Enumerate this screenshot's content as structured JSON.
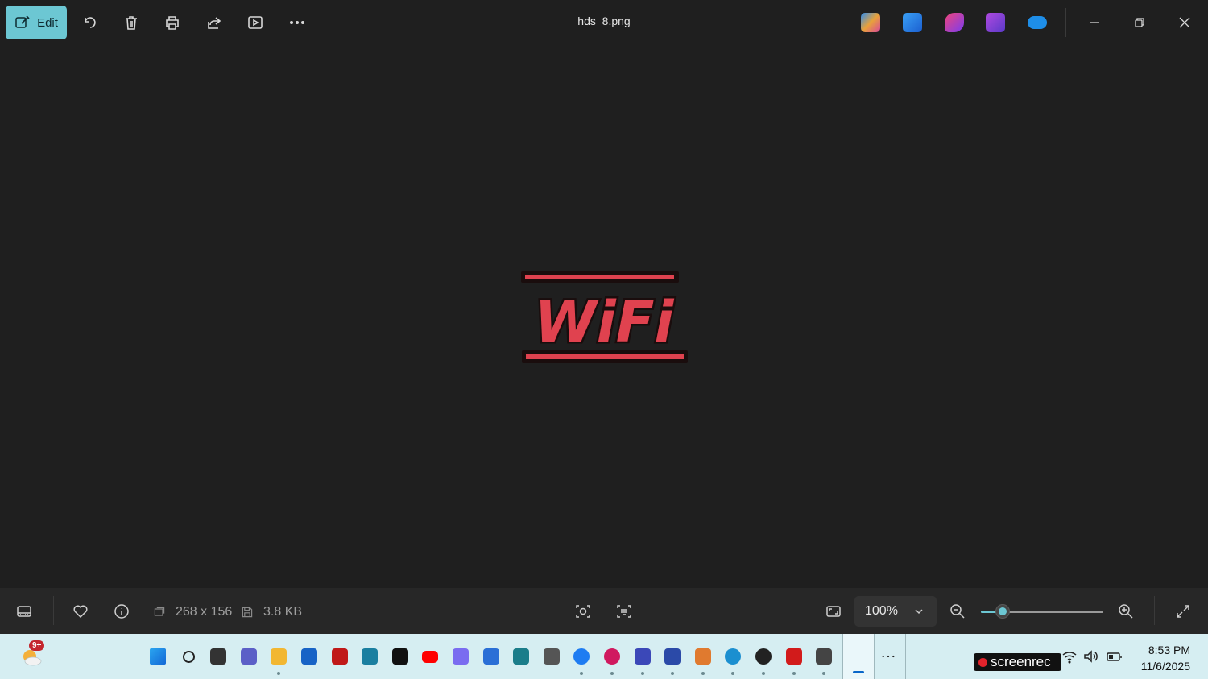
{
  "window": {
    "title": "hds_8.png",
    "edit_label": "Edit"
  },
  "toolbar": {
    "icons": [
      "rotate-icon",
      "delete-icon",
      "print-icon",
      "share-icon",
      "slideshow-icon",
      "more-icon"
    ]
  },
  "header_apps": [
    "copilot-icon",
    "photos-icon",
    "designer-icon",
    "clipchamp-icon",
    "onedrive-icon"
  ],
  "image": {
    "text": "WiFi",
    "text_color": "#e0424f",
    "outline_color": "#1a0d0d"
  },
  "bottombar": {
    "dimensions": "268 x 156",
    "file_size": "3.8 KB",
    "zoom_value": "100%",
    "zoom_slider_level": 0.18
  },
  "taskbar": {
    "weather_badge": "9+",
    "screenrec_label": "screenrec",
    "time": "8:53 PM",
    "date": "11/6/2025",
    "apps": [
      {
        "name": "start-icon",
        "color": "#1a8fe0"
      },
      {
        "name": "search-icon",
        "color": "#222222"
      },
      {
        "name": "task-view-icon",
        "color": "#333333"
      },
      {
        "name": "teams-icon",
        "color": "#5b5fc7"
      },
      {
        "name": "file-explorer-icon",
        "color": "#f2b732"
      },
      {
        "name": "store-icon",
        "color": "#1763c6"
      },
      {
        "name": "mcafee-icon",
        "color": "#c01818"
      },
      {
        "name": "alexa-icon",
        "color": "#1a7fa0"
      },
      {
        "name": "amazon-icon",
        "color": "#111111"
      },
      {
        "name": "youtube-icon",
        "color": "#ff0000"
      },
      {
        "name": "copilot-app-icon",
        "color": "#7a6cf0"
      },
      {
        "name": "todo-icon",
        "color": "#2a6fd6"
      },
      {
        "name": "app-icon",
        "color": "#1b7d8a"
      },
      {
        "name": "calculator-icon",
        "color": "#555555"
      },
      {
        "name": "messenger-icon",
        "color": "#1e7cf2"
      },
      {
        "name": "w-app-icon",
        "color": "#d0195f"
      },
      {
        "name": "proton-icon",
        "color": "#3b48b8"
      },
      {
        "name": "blocker-icon",
        "color": "#2b4aa8"
      },
      {
        "name": "copilot-icon-2",
        "color": "#e07a2f"
      },
      {
        "name": "edge-icon",
        "color": "#1b8fd0"
      },
      {
        "name": "chatgpt-icon",
        "color": "#222222"
      },
      {
        "name": "acrobat-icon",
        "color": "#d21b1b"
      },
      {
        "name": "terminal-icon",
        "color": "#444444"
      },
      {
        "name": "photos-app-icon",
        "color": "#2a7fd6"
      }
    ]
  }
}
